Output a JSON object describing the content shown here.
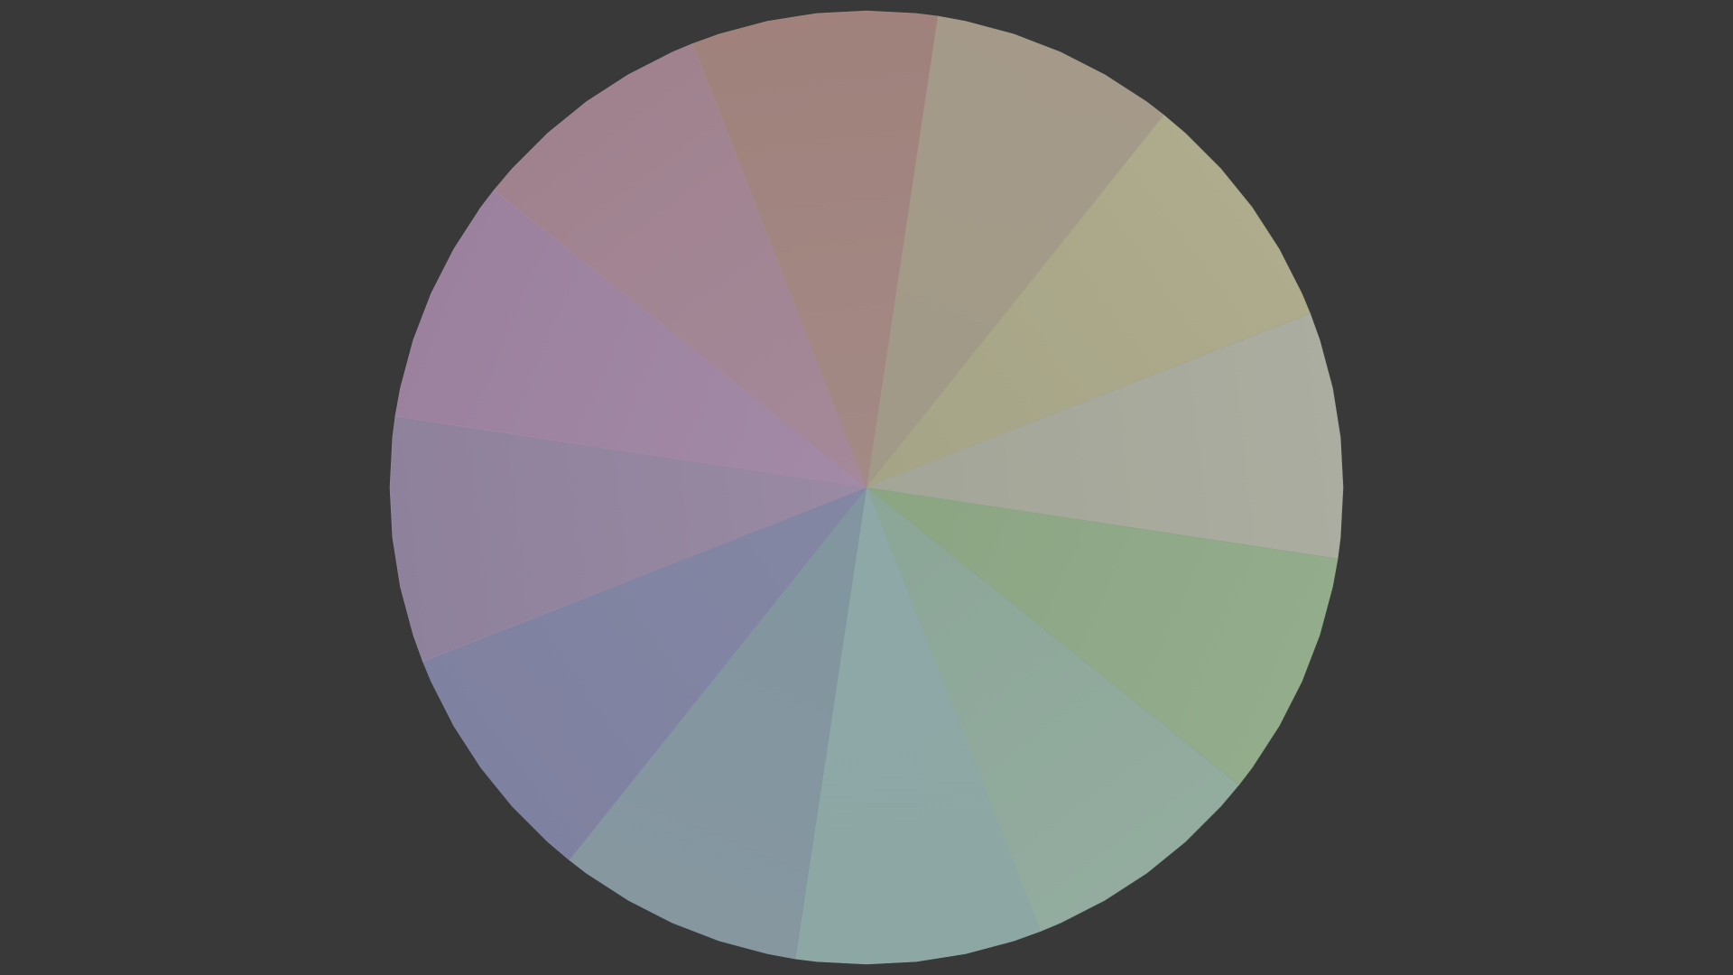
{
  "scene": {
    "background_color": "#393939",
    "segments": [
      {
        "color_outer": "#a59a89",
        "color_inner": "#a19a88"
      },
      {
        "color_outer": "#afab8d",
        "color_inner": "#a5a486"
      },
      {
        "color_outer": "#abada0",
        "color_inner": "#a3a598"
      },
      {
        "color_outer": "#93ac8c",
        "color_inner": "#8ba583"
      },
      {
        "color_outer": "#93ac9f",
        "color_inner": "#8ba597"
      },
      {
        "color_outer": "#8da7a5",
        "color_inner": "#8da8a6"
      },
      {
        "color_outer": "#8697a0",
        "color_inner": "#8195a0"
      },
      {
        "color_outer": "#7f81a0",
        "color_inner": "#8387a3"
      },
      {
        "color_outer": "#8e819c",
        "color_inner": "#9a8aa3"
      },
      {
        "color_outer": "#9b819e",
        "color_inner": "#a38aa6"
      },
      {
        "color_outer": "#a0828e",
        "color_inner": "#a5899a"
      },
      {
        "color_outer": "#a0817c",
        "color_inner": "#a38a85"
      }
    ]
  }
}
